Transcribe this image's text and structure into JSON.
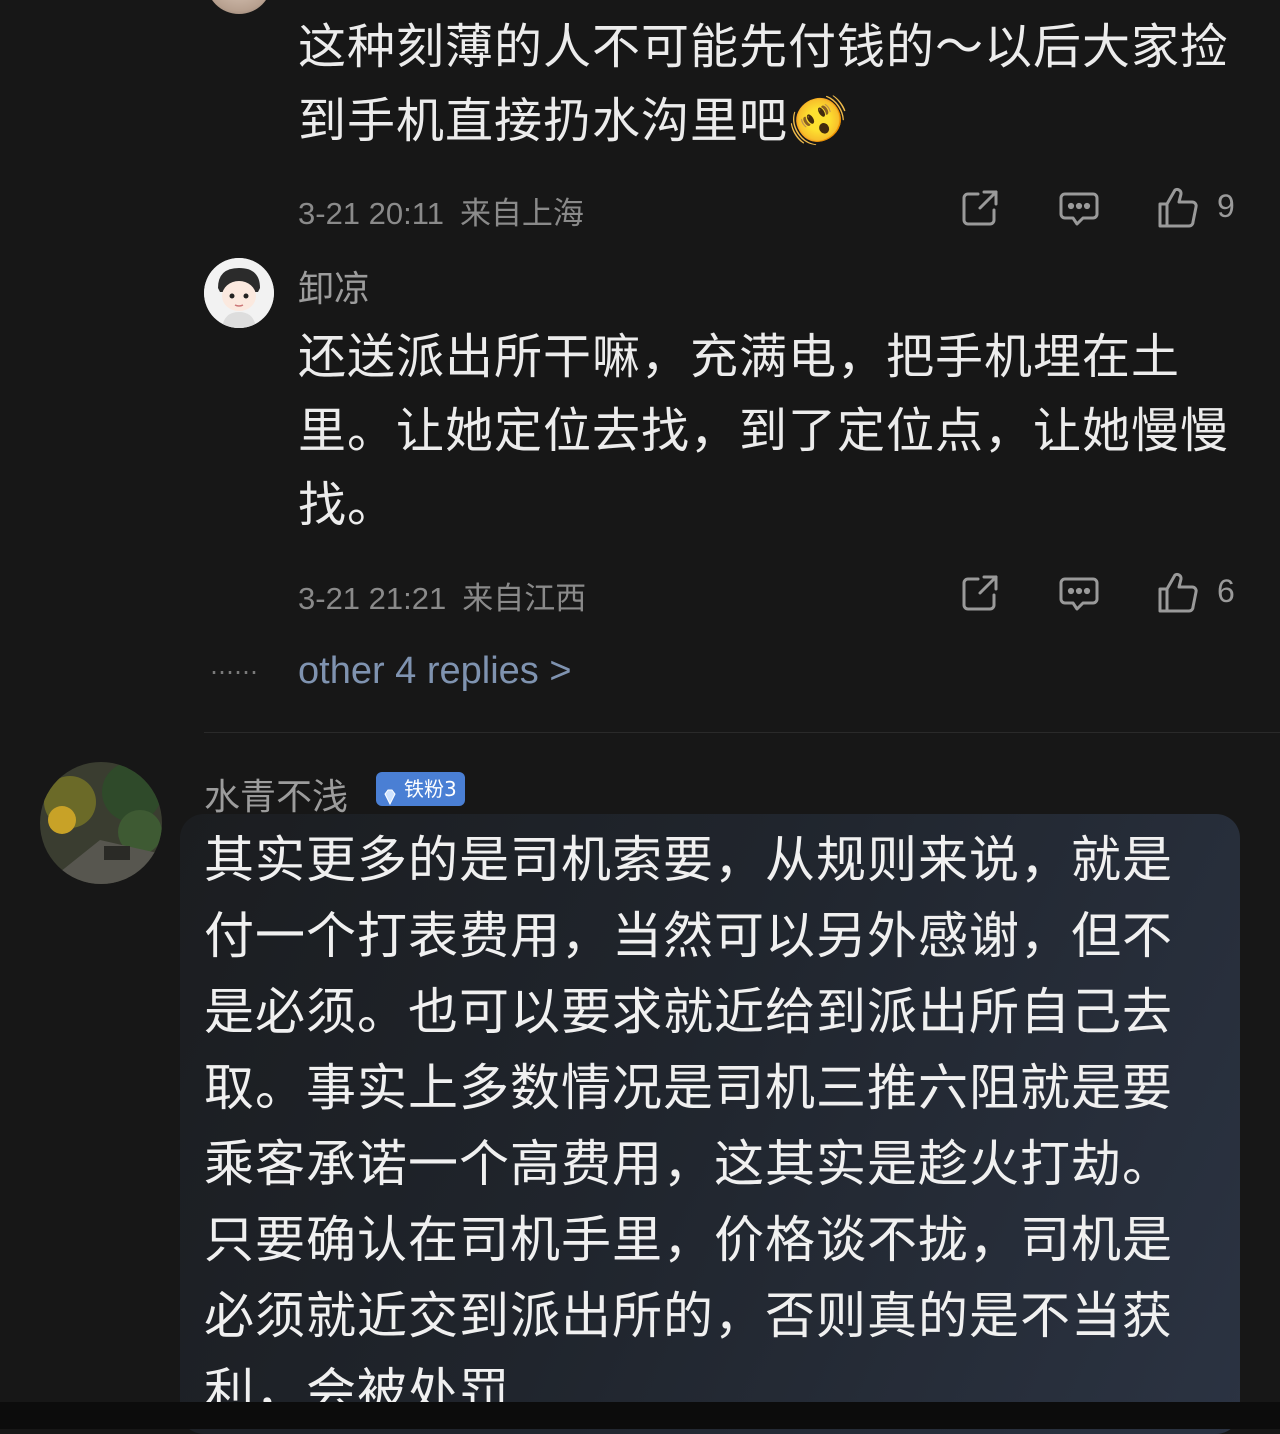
{
  "reply1": {
    "text": "这种刻薄的人不可能先付钱的～以后大家捡到手机直接扔水沟里吧",
    "emoji": "🫨",
    "time": "3-21 20:11",
    "location": "来自上海",
    "likes": "9"
  },
  "reply2": {
    "username": "卸凉",
    "text": "还送派出所干嘛，充满电，把手机埋在土里。让她定位去找，到了定位点，让她慢慢找。",
    "time": "3-21 21:21",
    "location": "来自江西",
    "likes": "6"
  },
  "more_replies": {
    "dots": "……",
    "label": "other 4 replies >"
  },
  "comment": {
    "username": "水青不浅",
    "badge": "铁粉3",
    "text": "其实更多的是司机索要，从规则来说，就是付一个打表费用，当然可以另外感谢，但不是必须。也可以要求就近给到派出所自己去取。事实上多数情况是司机三推六阻就是要乘客承诺一个高费用，这其实是趁火打劫。只要确认在司机手里，价格谈不拢，司机是必须就近交到派出所的，否则真的是不当获利，会被处罚"
  },
  "icons": {
    "share": "share-icon",
    "comment": "comment-icon",
    "like": "thumbs-up-icon",
    "badge": "diamond-icon"
  },
  "colors": {
    "background": "#171717",
    "link": "#7f93b0",
    "badge": "#4a7fd4"
  }
}
